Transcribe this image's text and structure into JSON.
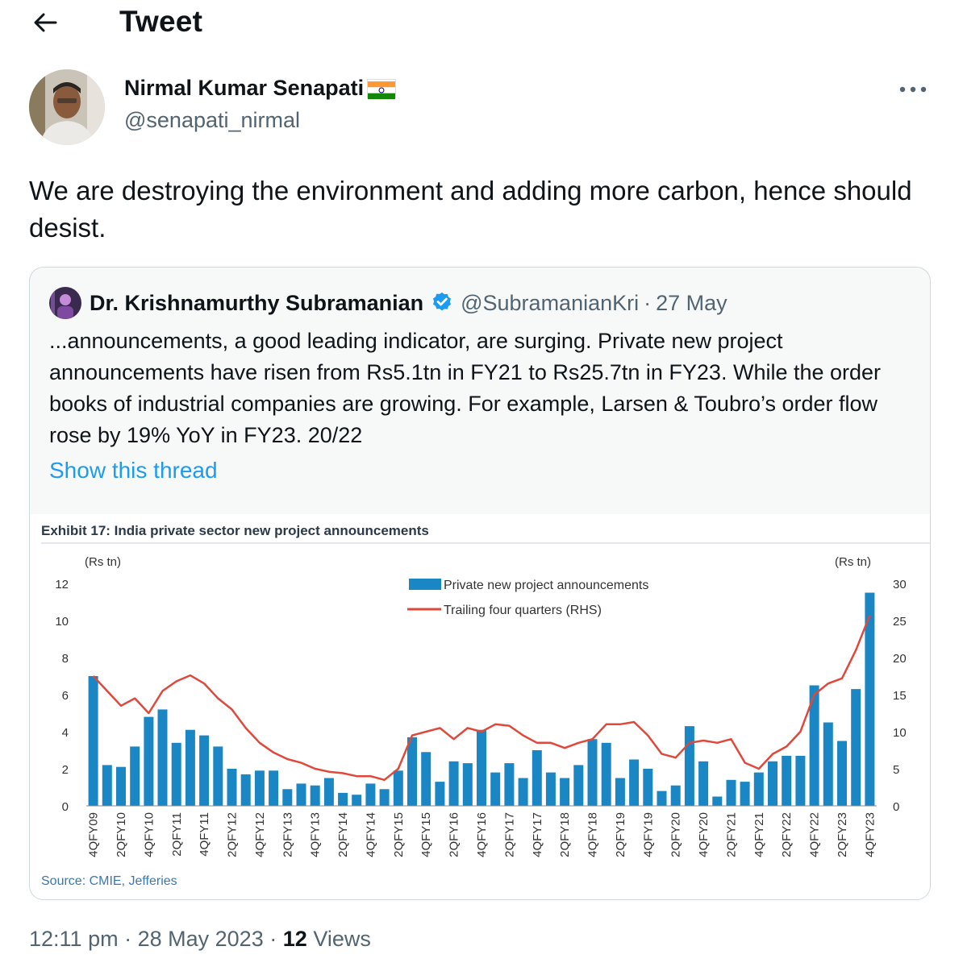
{
  "header": {
    "title": "Tweet"
  },
  "tweet": {
    "author_name": "Nirmal Kumar Senapati",
    "author_handle": "@senapati_nirmal",
    "text": "We are destroying the environment and adding more carbon, hence should desist.",
    "time": "12:11 pm",
    "date": "28 May 2023",
    "views_count": "12",
    "views_label": "Views",
    "sep": "·"
  },
  "quote": {
    "author_name": "Dr. Krishnamurthy Subramanian",
    "author_handle": "@SubramanianKri",
    "date": "27 May",
    "sep": "·",
    "text": "...announcements, a good leading indicator, are surging. Private new project announcements have risen from Rs5.1tn in FY21 to Rs25.7tn in FY23. While the order books of industrial companies are growing. For example, Larsen & Toubro’s order flow rose by 19% YoY in FY23. 20/22",
    "show_thread": "Show this thread"
  },
  "colors": {
    "bar": "#1a86c4",
    "line": "#e0483b",
    "link": "#1d9bf0",
    "verified": "#1d9bf0"
  },
  "chart_data": {
    "type": "bar",
    "title": "Exhibit 17: India private sector new project announcements",
    "left_unit": "(Rs tn)",
    "right_unit": "(Rs tn)",
    "source": "Source: CMIE, Jefferies",
    "ylim": [
      0,
      12
    ],
    "y2lim": [
      0,
      30
    ],
    "yticks": [
      0,
      2,
      4,
      6,
      8,
      10,
      12
    ],
    "y2ticks": [
      0,
      5,
      10,
      15,
      20,
      25,
      30
    ],
    "legend_position": "top-center",
    "x_tick_labels": [
      "4QFY09",
      "2QFY10",
      "4QFY10",
      "2QFY11",
      "4QFY11",
      "2QFY12",
      "4QFY12",
      "2QFY13",
      "4QFY13",
      "2QFY14",
      "4QFY14",
      "2QFY15",
      "4QFY15",
      "2QFY16",
      "4QFY16",
      "2QFY17",
      "4QFY17",
      "2QFY18",
      "4QFY18",
      "2QFY19",
      "4QFY19",
      "2QFY20",
      "4QFY20",
      "2QFY21",
      "4QFY21",
      "2QFY22",
      "4QFY22",
      "2QFY23",
      "4QFY23"
    ],
    "series": [
      {
        "name": "Private new project announcements",
        "axis": "left",
        "type": "bar",
        "values": [
          7.0,
          2.2,
          2.1,
          3.2,
          4.8,
          5.2,
          3.4,
          4.1,
          3.8,
          3.2,
          2.0,
          1.7,
          1.9,
          1.9,
          0.9,
          1.2,
          1.1,
          1.5,
          0.7,
          0.6,
          1.2,
          0.9,
          1.9,
          3.7,
          2.9,
          1.3,
          2.4,
          2.3,
          4.1,
          1.8,
          2.3,
          1.5,
          3.0,
          1.8,
          1.5,
          2.2,
          3.6,
          3.4,
          1.5,
          2.5,
          2.0,
          0.8,
          1.1,
          4.3,
          2.4,
          0.5,
          1.4,
          1.3,
          1.8,
          2.4,
          2.7,
          2.7,
          6.5,
          4.5,
          3.5,
          6.3,
          11.5
        ]
      },
      {
        "name": "Trailing four quarters (RHS)",
        "axis": "right",
        "type": "line",
        "values": [
          17.5,
          15.5,
          13.5,
          14.5,
          12.5,
          15.5,
          16.8,
          17.6,
          16.5,
          14.5,
          13.0,
          10.5,
          8.5,
          7.2,
          6.3,
          5.8,
          5.0,
          4.6,
          4.4,
          4.0,
          4.0,
          3.5,
          5.0,
          9.5,
          10.0,
          10.5,
          9.0,
          10.5,
          10.0,
          11.0,
          10.8,
          9.5,
          8.5,
          8.5,
          7.8,
          8.5,
          9.0,
          11.0,
          11.0,
          11.3,
          9.5,
          7.0,
          6.5,
          8.5,
          8.8,
          8.5,
          9.0,
          5.8,
          5.0,
          7.0,
          8.0,
          10.0,
          15.0,
          16.5,
          17.2,
          21.0,
          25.7
        ]
      }
    ]
  }
}
